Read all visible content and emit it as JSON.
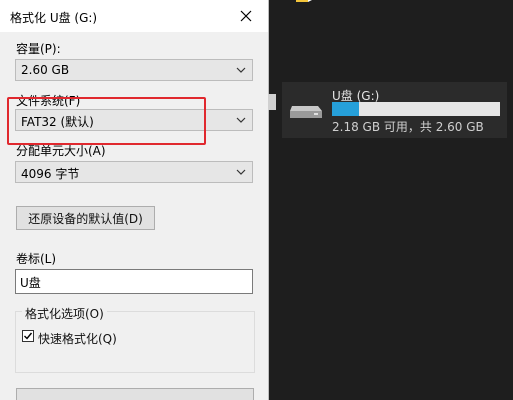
{
  "dialog": {
    "title": "格式化 U盘 (G:)",
    "capacity": {
      "label": "容量(P):",
      "value": "2.60 GB"
    },
    "filesystem": {
      "label": "文件系统(F)",
      "value": "FAT32 (默认)"
    },
    "allocation": {
      "label": "分配单元大小(A)",
      "value": "4096 字节"
    },
    "restore_label": "还原设备的默认值(D)",
    "volume": {
      "label": "卷标(L)",
      "value": "U盘"
    },
    "format_options": {
      "label": "格式化选项(O)",
      "quick_format_label": "快速格式化(Q)",
      "quick_format_checked": true
    }
  },
  "drive": {
    "name": "U盘 (G:)",
    "info": "2.18 GB 可用，共 2.60 GB",
    "used_fraction": 0.16,
    "bar_color": "#26a0da"
  },
  "highlight_color": "#e0282e",
  "icons": {
    "close": "close-icon",
    "dropdown": "chevron-down-icon",
    "drive": "usb-drive-icon",
    "check": "checkmark-icon"
  }
}
